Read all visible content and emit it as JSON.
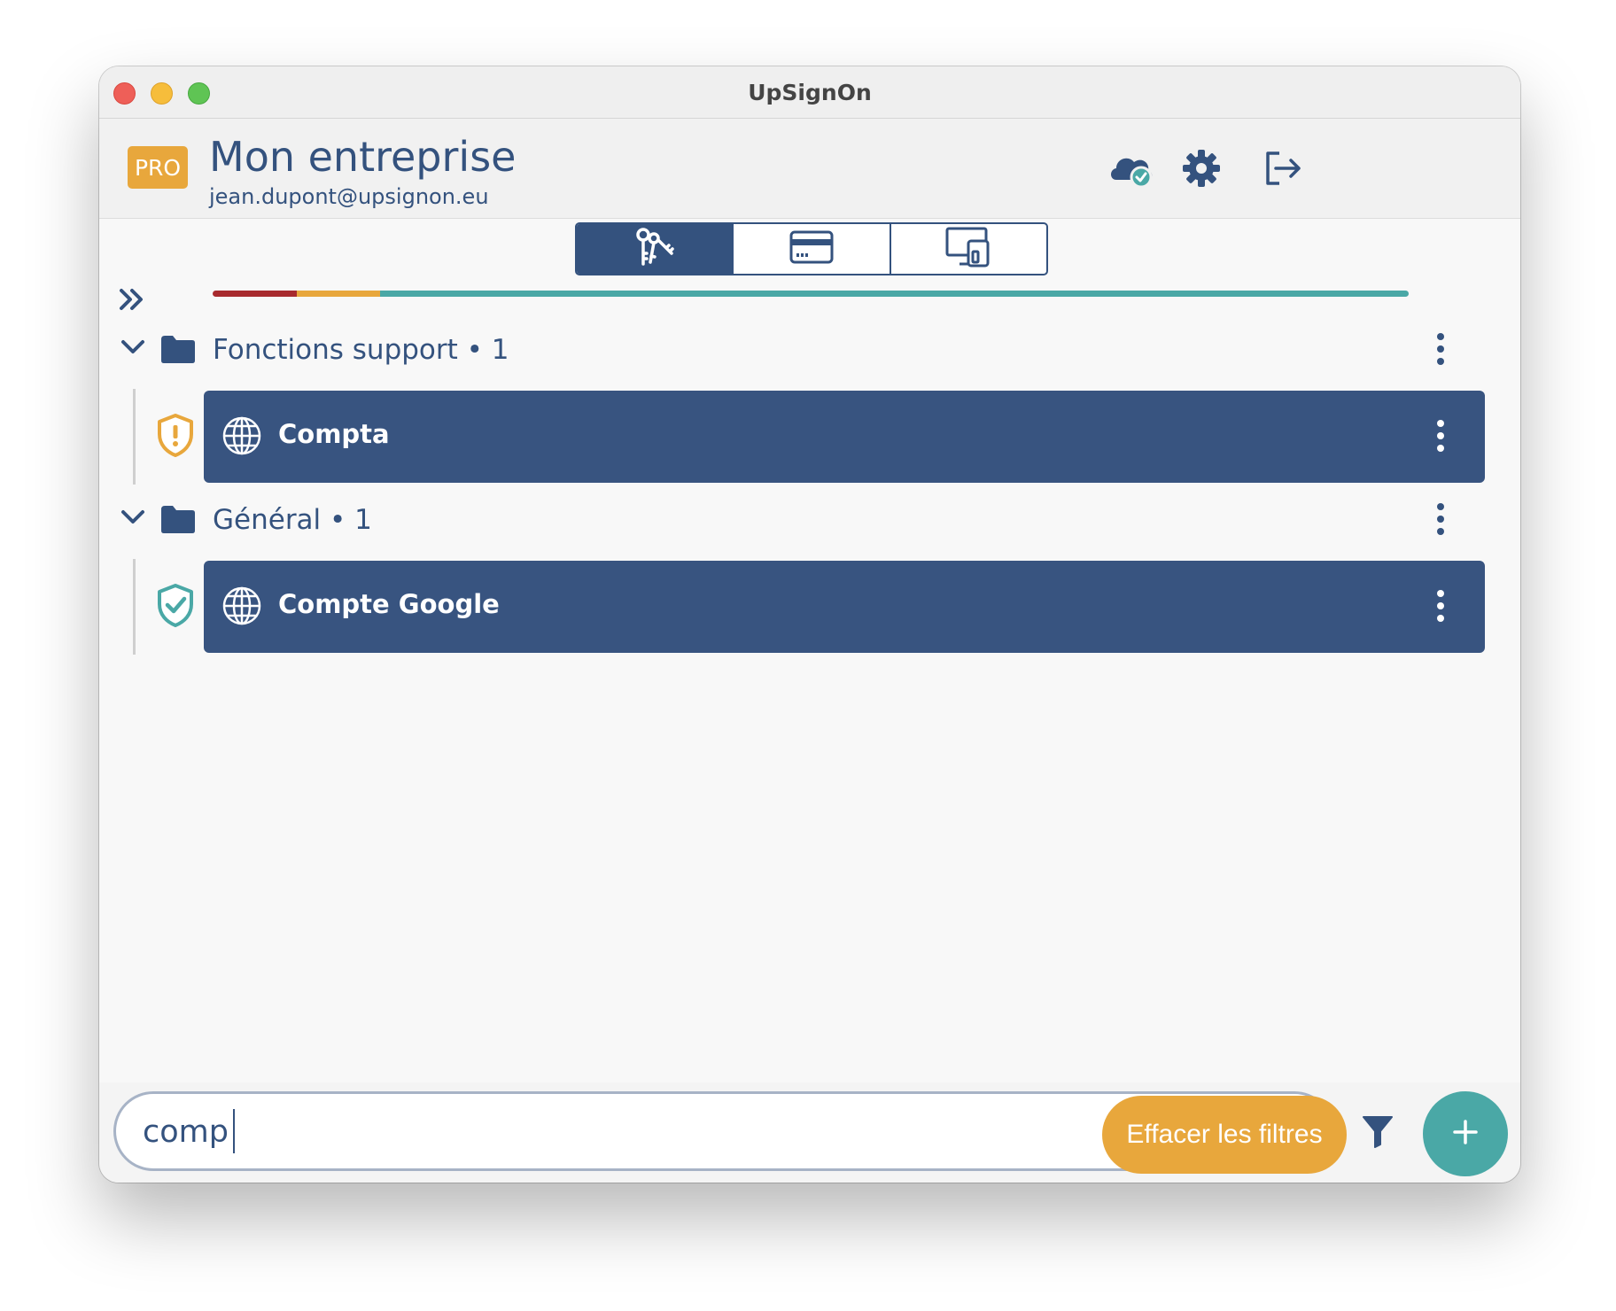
{
  "window": {
    "title": "UpSignOn"
  },
  "header": {
    "badge": "PRO",
    "organization": "Mon entreprise",
    "email": "jean.dupont@upsignon.eu",
    "icons": [
      "cloud-sync-icon",
      "gear-icon",
      "logout-icon"
    ]
  },
  "tabs": [
    {
      "icon": "keys-icon",
      "active": true
    },
    {
      "icon": "credit-card-icon",
      "active": false
    },
    {
      "icon": "devices-icon",
      "active": false
    }
  ],
  "strength_bar": {
    "segments": [
      {
        "status": "weak",
        "fraction": 0.07,
        "color": "#a82a2e"
      },
      {
        "status": "medium",
        "fraction": 0.07,
        "color": "#e8a73c"
      },
      {
        "status": "strong",
        "fraction": 0.86,
        "color": "#4aa8a6"
      }
    ]
  },
  "groups": [
    {
      "label": "Fonctions support • 1",
      "accounts": [
        {
          "name": "Compta",
          "security": "warning",
          "security_color": "#e8a73c"
        }
      ]
    },
    {
      "label": "Général • 1",
      "accounts": [
        {
          "name": "Compte Google",
          "security": "ok",
          "security_color": "#4aa8a6"
        }
      ]
    }
  ],
  "search": {
    "value": "comp",
    "clear_label": "Effacer les filtres"
  },
  "colors": {
    "primary": "#34527e",
    "accent": "#e8a73c",
    "teal": "#4aa8a6"
  }
}
